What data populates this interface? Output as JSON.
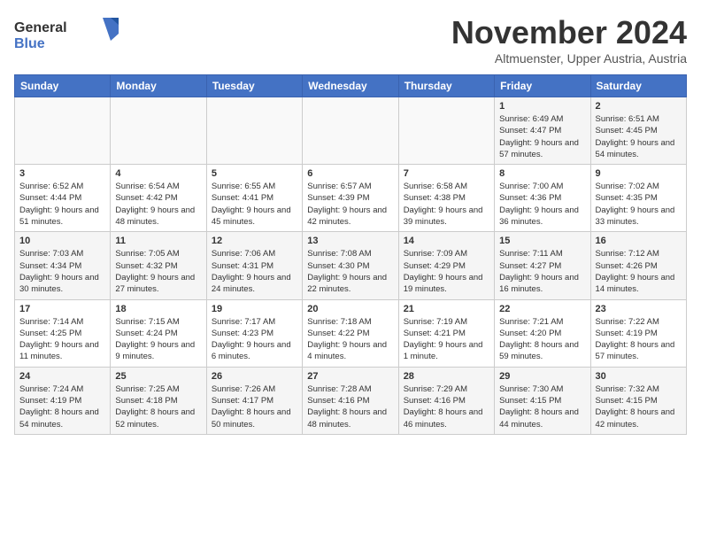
{
  "logo": {
    "text1": "General",
    "text2": "Blue"
  },
  "title": "November 2024",
  "location": "Altmuenster, Upper Austria, Austria",
  "weekdays": [
    "Sunday",
    "Monday",
    "Tuesday",
    "Wednesday",
    "Thursday",
    "Friday",
    "Saturday"
  ],
  "weeks": [
    [
      {
        "day": "",
        "info": ""
      },
      {
        "day": "",
        "info": ""
      },
      {
        "day": "",
        "info": ""
      },
      {
        "day": "",
        "info": ""
      },
      {
        "day": "",
        "info": ""
      },
      {
        "day": "1",
        "info": "Sunrise: 6:49 AM\nSunset: 4:47 PM\nDaylight: 9 hours and 57 minutes."
      },
      {
        "day": "2",
        "info": "Sunrise: 6:51 AM\nSunset: 4:45 PM\nDaylight: 9 hours and 54 minutes."
      }
    ],
    [
      {
        "day": "3",
        "info": "Sunrise: 6:52 AM\nSunset: 4:44 PM\nDaylight: 9 hours and 51 minutes."
      },
      {
        "day": "4",
        "info": "Sunrise: 6:54 AM\nSunset: 4:42 PM\nDaylight: 9 hours and 48 minutes."
      },
      {
        "day": "5",
        "info": "Sunrise: 6:55 AM\nSunset: 4:41 PM\nDaylight: 9 hours and 45 minutes."
      },
      {
        "day": "6",
        "info": "Sunrise: 6:57 AM\nSunset: 4:39 PM\nDaylight: 9 hours and 42 minutes."
      },
      {
        "day": "7",
        "info": "Sunrise: 6:58 AM\nSunset: 4:38 PM\nDaylight: 9 hours and 39 minutes."
      },
      {
        "day": "8",
        "info": "Sunrise: 7:00 AM\nSunset: 4:36 PM\nDaylight: 9 hours and 36 minutes."
      },
      {
        "day": "9",
        "info": "Sunrise: 7:02 AM\nSunset: 4:35 PM\nDaylight: 9 hours and 33 minutes."
      }
    ],
    [
      {
        "day": "10",
        "info": "Sunrise: 7:03 AM\nSunset: 4:34 PM\nDaylight: 9 hours and 30 minutes."
      },
      {
        "day": "11",
        "info": "Sunrise: 7:05 AM\nSunset: 4:32 PM\nDaylight: 9 hours and 27 minutes."
      },
      {
        "day": "12",
        "info": "Sunrise: 7:06 AM\nSunset: 4:31 PM\nDaylight: 9 hours and 24 minutes."
      },
      {
        "day": "13",
        "info": "Sunrise: 7:08 AM\nSunset: 4:30 PM\nDaylight: 9 hours and 22 minutes."
      },
      {
        "day": "14",
        "info": "Sunrise: 7:09 AM\nSunset: 4:29 PM\nDaylight: 9 hours and 19 minutes."
      },
      {
        "day": "15",
        "info": "Sunrise: 7:11 AM\nSunset: 4:27 PM\nDaylight: 9 hours and 16 minutes."
      },
      {
        "day": "16",
        "info": "Sunrise: 7:12 AM\nSunset: 4:26 PM\nDaylight: 9 hours and 14 minutes."
      }
    ],
    [
      {
        "day": "17",
        "info": "Sunrise: 7:14 AM\nSunset: 4:25 PM\nDaylight: 9 hours and 11 minutes."
      },
      {
        "day": "18",
        "info": "Sunrise: 7:15 AM\nSunset: 4:24 PM\nDaylight: 9 hours and 9 minutes."
      },
      {
        "day": "19",
        "info": "Sunrise: 7:17 AM\nSunset: 4:23 PM\nDaylight: 9 hours and 6 minutes."
      },
      {
        "day": "20",
        "info": "Sunrise: 7:18 AM\nSunset: 4:22 PM\nDaylight: 9 hours and 4 minutes."
      },
      {
        "day": "21",
        "info": "Sunrise: 7:19 AM\nSunset: 4:21 PM\nDaylight: 9 hours and 1 minute."
      },
      {
        "day": "22",
        "info": "Sunrise: 7:21 AM\nSunset: 4:20 PM\nDaylight: 8 hours and 59 minutes."
      },
      {
        "day": "23",
        "info": "Sunrise: 7:22 AM\nSunset: 4:19 PM\nDaylight: 8 hours and 57 minutes."
      }
    ],
    [
      {
        "day": "24",
        "info": "Sunrise: 7:24 AM\nSunset: 4:19 PM\nDaylight: 8 hours and 54 minutes."
      },
      {
        "day": "25",
        "info": "Sunrise: 7:25 AM\nSunset: 4:18 PM\nDaylight: 8 hours and 52 minutes."
      },
      {
        "day": "26",
        "info": "Sunrise: 7:26 AM\nSunset: 4:17 PM\nDaylight: 8 hours and 50 minutes."
      },
      {
        "day": "27",
        "info": "Sunrise: 7:28 AM\nSunset: 4:16 PM\nDaylight: 8 hours and 48 minutes."
      },
      {
        "day": "28",
        "info": "Sunrise: 7:29 AM\nSunset: 4:16 PM\nDaylight: 8 hours and 46 minutes."
      },
      {
        "day": "29",
        "info": "Sunrise: 7:30 AM\nSunset: 4:15 PM\nDaylight: 8 hours and 44 minutes."
      },
      {
        "day": "30",
        "info": "Sunrise: 7:32 AM\nSunset: 4:15 PM\nDaylight: 8 hours and 42 minutes."
      }
    ]
  ]
}
